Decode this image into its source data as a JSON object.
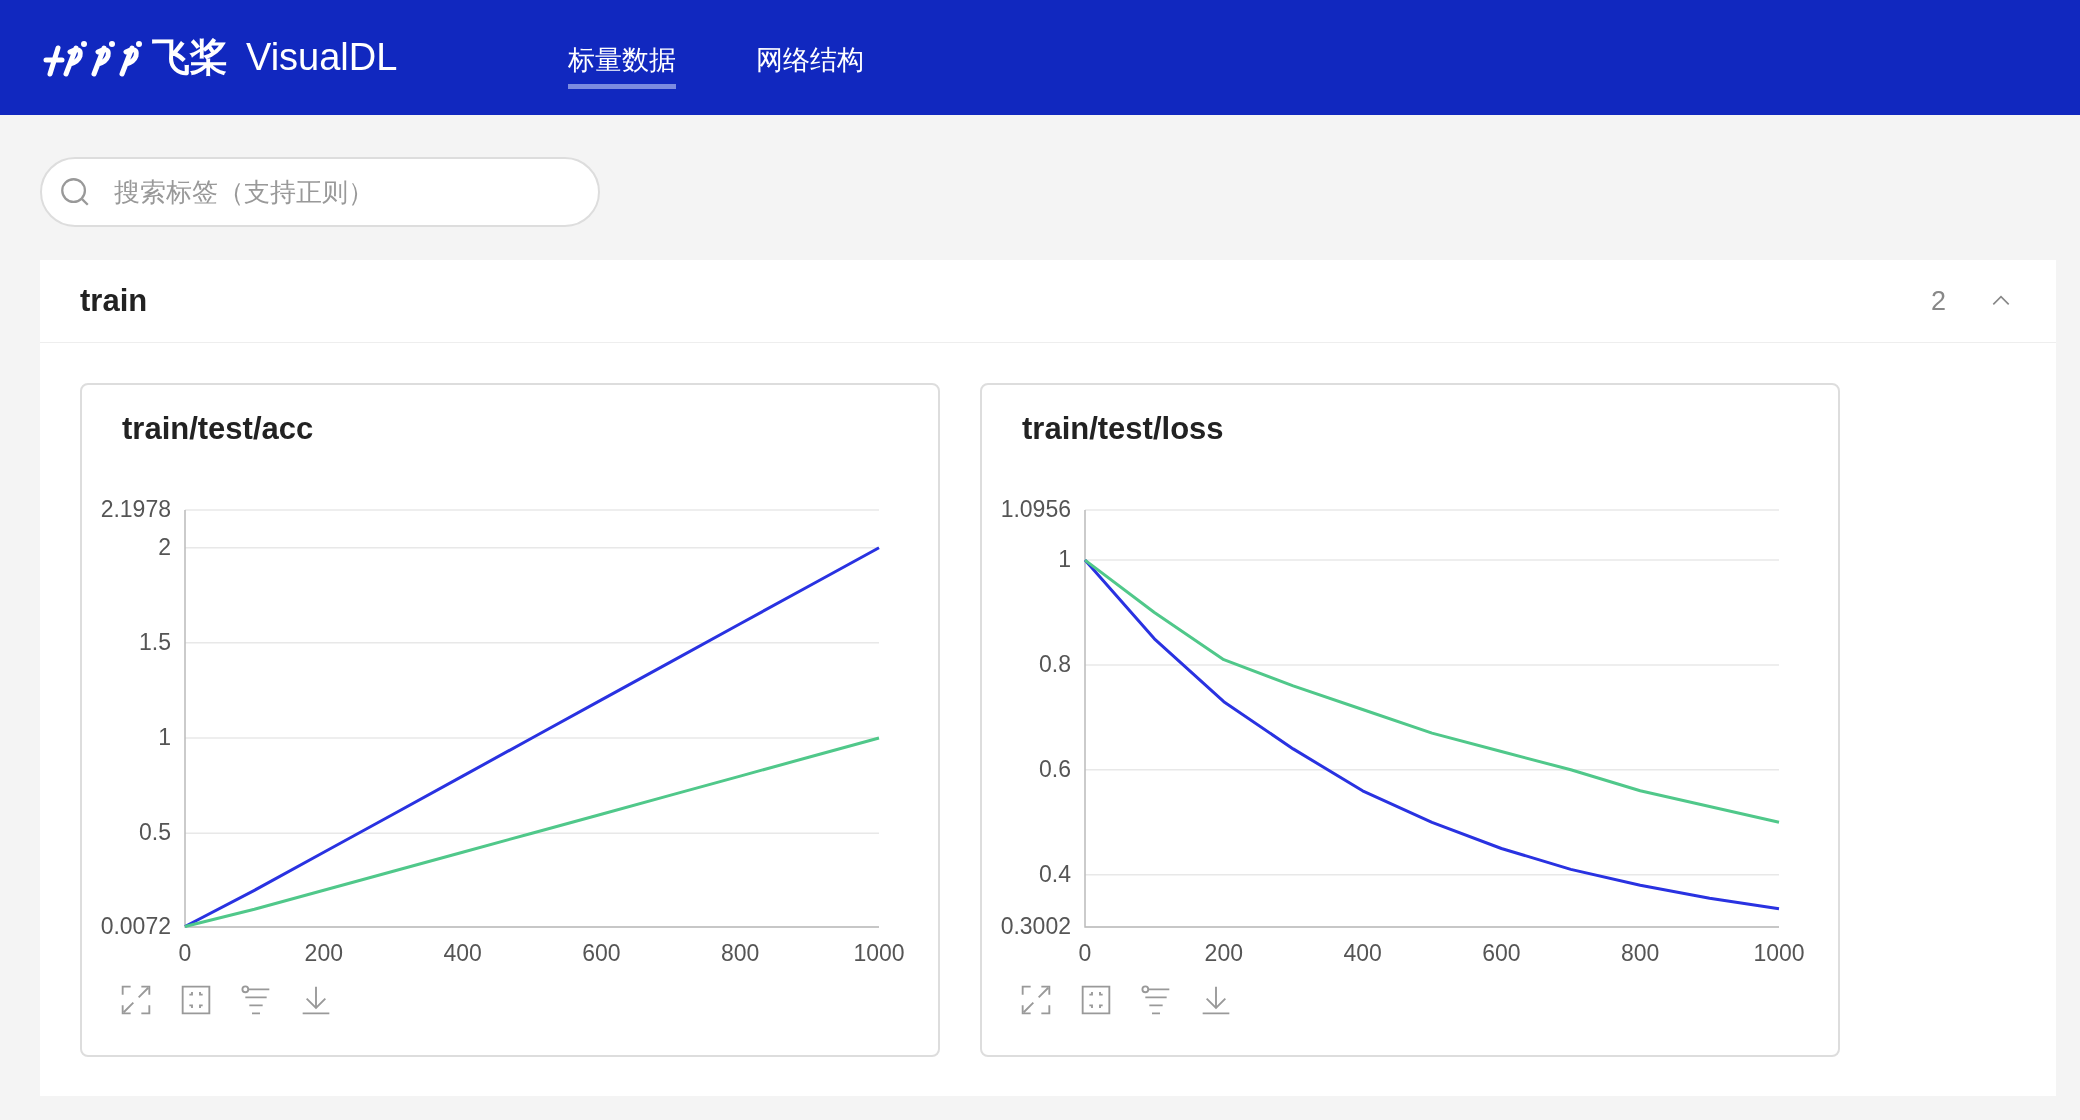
{
  "header": {
    "logo_text": "飞桨",
    "app_name": "VisualDL",
    "tabs": [
      {
        "label": "标量数据",
        "selected": true
      },
      {
        "label": "网络结构",
        "selected": false
      }
    ]
  },
  "search": {
    "placeholder": "搜索标签（支持正则）"
  },
  "sections": [
    {
      "title": "train",
      "count": "2",
      "expanded": true,
      "charts": [
        {
          "title": "train/test/acc",
          "chart_data": {
            "type": "line",
            "x": [
              0,
              100,
              200,
              300,
              400,
              500,
              600,
              700,
              800,
              900,
              1000
            ],
            "series": [
              {
                "color": "#2932e1",
                "values": [
                  0.01,
                  0.2,
                  0.4,
                  0.6,
                  0.8,
                  1.0,
                  1.2,
                  1.4,
                  1.6,
                  1.8,
                  2.0
                ]
              },
              {
                "color": "#50c88a",
                "values": [
                  0.01,
                  0.1,
                  0.2,
                  0.3,
                  0.4,
                  0.5,
                  0.6,
                  0.7,
                  0.8,
                  0.9,
                  1.0
                ]
              }
            ],
            "grid": true,
            "xlim": [
              0,
              1000
            ],
            "ylim": [
              0.0072,
              2.1978
            ],
            "xticks": [
              0,
              200,
              400,
              600,
              800,
              1000
            ],
            "yticks": [
              0.0072,
              0.5,
              1,
              1.5,
              2,
              2.1978
            ]
          }
        },
        {
          "title": "train/test/loss",
          "chart_data": {
            "type": "line",
            "x": [
              0,
              100,
              200,
              300,
              400,
              500,
              600,
              700,
              800,
              900,
              1000
            ],
            "series": [
              {
                "color": "#2932e1",
                "values": [
                  1.0,
                  0.85,
                  0.73,
                  0.64,
                  0.56,
                  0.5,
                  0.45,
                  0.41,
                  0.38,
                  0.355,
                  0.335
                ]
              },
              {
                "color": "#50c88a",
                "values": [
                  1.0,
                  0.9,
                  0.81,
                  0.76,
                  0.715,
                  0.67,
                  0.635,
                  0.6,
                  0.56,
                  0.53,
                  0.5
                ]
              }
            ],
            "grid": true,
            "xlim": [
              0,
              1000
            ],
            "ylim": [
              0.3002,
              1.0956
            ],
            "xticks": [
              0,
              200,
              400,
              600,
              800,
              1000
            ],
            "yticks": [
              0.3002,
              0.4,
              0.6,
              0.8,
              1,
              1.0956
            ]
          }
        }
      ]
    }
  ]
}
